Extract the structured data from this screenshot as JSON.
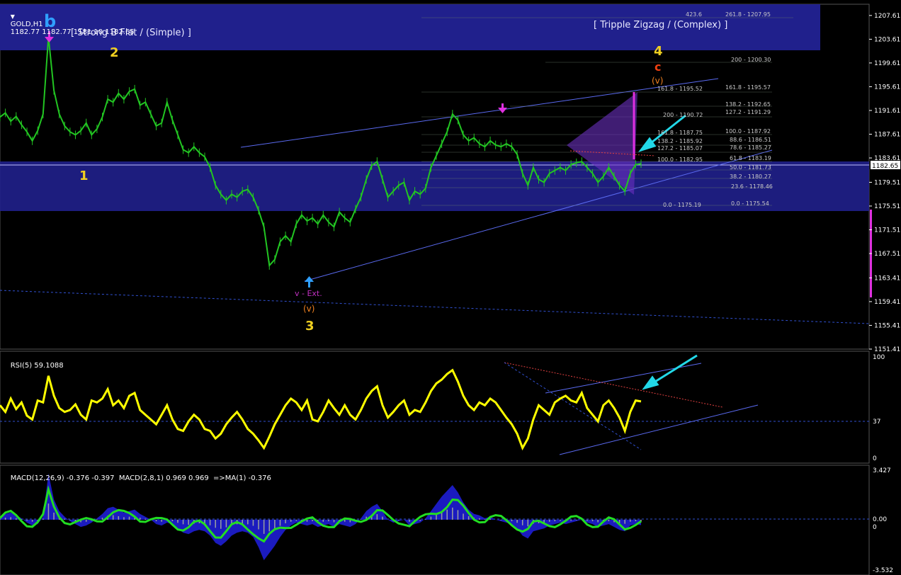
{
  "header": {
    "symbol": "GOLD,H1",
    "ohlc": "1182.77 1182.77 1181.10 1182.65",
    "rsi_label": "RSI(5) 59.1088",
    "macd_label": "MACD(12,26,9) -0.376 -0.397  MACD(2,8,1) 0.969 0.969  =>MA(1) -0.376"
  },
  "price_axis": {
    "ticks": [
      "1207.61",
      "1203.61",
      "1199.61",
      "1195.61",
      "1191.61",
      "1187.61",
      "1183.61",
      "1179.51",
      "1175.51",
      "1171.51",
      "1167.51",
      "1163.41",
      "1159.41",
      "1155.41",
      "1151.41"
    ],
    "current": "1182.65"
  },
  "rsi_axis": {
    "ticks": [
      "100",
      "37",
      "0"
    ]
  },
  "macd_axis": {
    "ticks": [
      "3.427",
      "0.00",
      "0",
      "-3.532"
    ]
  },
  "annotations": {
    "strong_b_flat": "[ Strong B Flat / (Simple) ]",
    "triple_zigzag": "[ Tripple Zigzag / (Complex) ]",
    "wave_b": "b",
    "wave_1": "1",
    "wave_2": "2",
    "wave_3": "3",
    "wave_4": "4",
    "v_ext": "v - Ext.",
    "v_paren": "(v)",
    "wave_c_top": "c",
    "wave_v_top": "(v)"
  },
  "fibonacci_levels": [
    "423.6",
    "261.8 - 1207.95",
    "200 - 1200.30",
    "161.8 - 1195.52",
    "161.8 - 1195.57",
    "138.2 - 1192.65",
    "200 - 1190.72",
    "127.2 - 1191.29",
    "161.8 - 1187.75",
    "100.0 - 1187.92",
    "138.2 - 1185.92",
    "88.6 - 1186.51",
    "127.2 - 1185.07",
    "78.6 - 1185.27",
    "100.0 - 1182.95",
    "61.8 - 1183.19",
    "50.0 - 1181.73",
    "38.2 - 1180.27",
    "23.6 - 1178.46",
    "0.0 - 1175.19",
    "0.0 - 1175.54"
  ],
  "colors": {
    "background": "#000000",
    "band": "#20208c",
    "candle": "#22c522",
    "rsi_line": "#ffff00",
    "macd_hist": "#2020e0",
    "macd_signal": "#22dd22",
    "arrow_cyan": "#22d8e8",
    "wave_orange": "#f08020",
    "wave_red": "#f04010",
    "wave_yellow": "#f0d020",
    "wave_magenta": "#c030c0",
    "wave_blue": "#30a0ff",
    "wave_green": "#60d060"
  },
  "chart_data": [
    {
      "type": "line",
      "title": "GOLD,H1",
      "ylim": [
        1151.41,
        1209.5
      ],
      "x_count": 120,
      "values": [
        1190.5,
        1191.2,
        1189.8,
        1190.6,
        1189.2,
        1188.0,
        1186.5,
        1188.2,
        1191.0,
        1204.0,
        1195.0,
        1191.0,
        1189.0,
        1188.0,
        1187.5,
        1188.2,
        1189.5,
        1187.5,
        1188.5,
        1190.5,
        1193.5,
        1193.0,
        1194.5,
        1193.5,
        1194.8,
        1195.2,
        1192.5,
        1193.0,
        1191.0,
        1189.0,
        1189.5,
        1193.0,
        1190.0,
        1187.5,
        1185.0,
        1184.5,
        1185.5,
        1184.5,
        1183.8,
        1182.0,
        1179.0,
        1177.5,
        1176.5,
        1177.5,
        1177.0,
        1178.0,
        1178.3,
        1177.0,
        1174.8,
        1172.0,
        1165.5,
        1166.5,
        1169.5,
        1170.5,
        1169.5,
        1172.5,
        1174.0,
        1173.0,
        1173.5,
        1172.5,
        1174.0,
        1172.8,
        1172.0,
        1174.5,
        1173.5,
        1172.8,
        1175.0,
        1177.0,
        1180.0,
        1182.3,
        1183.0,
        1180.0,
        1177.0,
        1178.0,
        1179.0,
        1179.5,
        1176.5,
        1178.0,
        1177.5,
        1178.5,
        1182.0,
        1184.0,
        1186.0,
        1188.0,
        1191.0,
        1190.0,
        1187.5,
        1186.5,
        1187.0,
        1186.0,
        1185.5,
        1186.5,
        1185.8,
        1185.5,
        1186.0,
        1185.5,
        1184.2,
        1181.0,
        1179.0,
        1182.0,
        1180.0,
        1179.5,
        1181.0,
        1181.5,
        1182.0,
        1181.5,
        1182.5,
        1182.8,
        1183.0,
        1182.0,
        1181.0,
        1179.5,
        1180.5,
        1182.0,
        1180.5,
        1179.0,
        1178.0,
        1181.0,
        1182.5,
        1182.65
      ]
    },
    {
      "type": "line",
      "title": "RSI(5) 59.1088",
      "ylim": [
        0,
        100
      ],
      "x_count": 120,
      "values": [
        55,
        48,
        62,
        51,
        58,
        44,
        40,
        60,
        58,
        86,
        65,
        52,
        48,
        50,
        56,
        45,
        40,
        60,
        58,
        62,
        72,
        55,
        60,
        52,
        65,
        68,
        50,
        45,
        40,
        35,
        45,
        55,
        40,
        30,
        28,
        38,
        45,
        40,
        30,
        28,
        20,
        25,
        35,
        42,
        48,
        40,
        30,
        25,
        18,
        10,
        22,
        35,
        45,
        55,
        62,
        58,
        50,
        60,
        40,
        38,
        48,
        60,
        52,
        45,
        55,
        45,
        40,
        50,
        62,
        70,
        75,
        55,
        42,
        48,
        55,
        60,
        45,
        50,
        48,
        58,
        70,
        78,
        82,
        88,
        92,
        80,
        65,
        55,
        50,
        58,
        55,
        62,
        58,
        50,
        42,
        35,
        25,
        10,
        20,
        40,
        55,
        50,
        45,
        58,
        62,
        65,
        60,
        58,
        68,
        52,
        45,
        38,
        55,
        60,
        52,
        42,
        28,
        48,
        60,
        59
      ]
    },
    {
      "type": "line",
      "title": "MACD(12,26,9)",
      "ylim": [
        -3.532,
        3.427
      ],
      "x_count": 120,
      "values": [
        0.2,
        0.4,
        0.5,
        0.3,
        0.1,
        -0.2,
        -0.4,
        -0.3,
        0.2,
        3.2,
        1.4,
        0.6,
        0.2,
        -0.1,
        -0.3,
        -0.5,
        -0.4,
        -0.2,
        0.1,
        0.4,
        0.8,
        0.9,
        0.7,
        0.5,
        0.6,
        0.7,
        0.4,
        0.2,
        0.0,
        -0.3,
        -0.4,
        -0.2,
        -0.3,
        -0.6,
        -0.9,
        -1.0,
        -0.8,
        -0.7,
        -0.8,
        -1.1,
        -1.6,
        -1.8,
        -1.5,
        -1.1,
        -0.9,
        -0.8,
        -0.9,
        -1.2,
        -1.9,
        -2.8,
        -2.3,
        -1.8,
        -1.2,
        -0.7,
        -0.4,
        -0.2,
        -0.3,
        -0.4,
        -0.3,
        -0.5,
        -0.4,
        -0.3,
        -0.5,
        -0.3,
        -0.4,
        -0.5,
        -0.3,
        0.1,
        0.6,
        0.9,
        1.1,
        0.6,
        0.0,
        -0.2,
        -0.1,
        0.0,
        -0.4,
        -0.3,
        -0.2,
        0.1,
        0.6,
        1.1,
        1.6,
        2.0,
        2.4,
        1.9,
        1.2,
        0.7,
        0.4,
        0.3,
        0.1,
        0.2,
        0.0,
        -0.1,
        -0.2,
        -0.3,
        -0.6,
        -1.1,
        -1.3,
        -0.8,
        -0.7,
        -0.6,
        -0.4,
        -0.3,
        -0.2,
        -0.3,
        -0.2,
        -0.1,
        0.0,
        -0.2,
        -0.3,
        -0.5,
        -0.4,
        -0.3,
        -0.5,
        -0.7,
        -0.8,
        -0.4,
        -0.3,
        -0.376
      ]
    }
  ]
}
